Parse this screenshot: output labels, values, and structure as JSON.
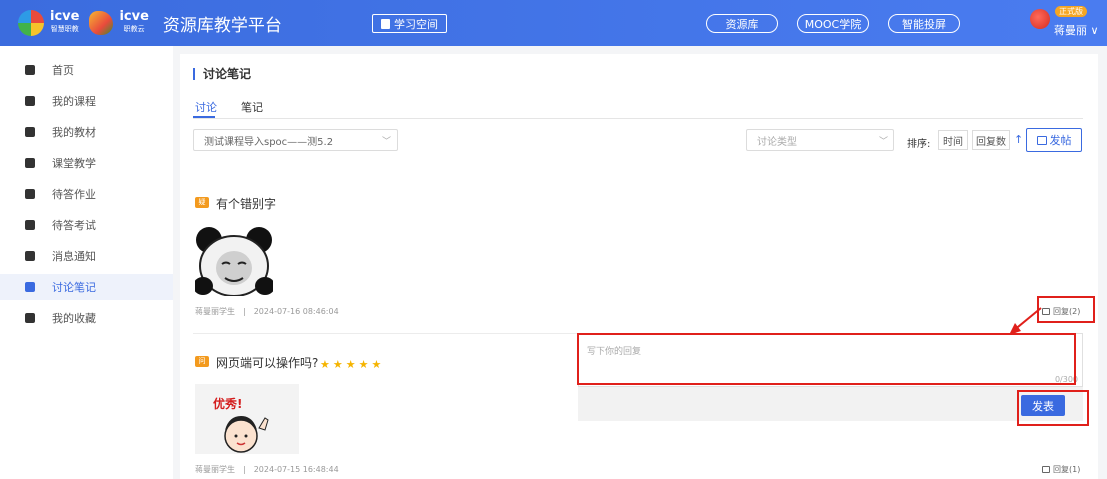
{
  "header": {
    "logo1_text": "icve",
    "logo1_sub": "智慧职教",
    "logo2_text": "icve",
    "logo2_sub": "职教云",
    "platform_title": "资源库教学平台",
    "study_space": "学习空间",
    "nav": [
      "资源库",
      "MOOC学院",
      "智能投屏"
    ],
    "vip_badge": "正式版",
    "username": "蒋曼丽 ∨"
  },
  "sidebar": {
    "items": [
      {
        "label": "首页",
        "icon": "home-icon"
      },
      {
        "label": "我的课程",
        "icon": "course-icon"
      },
      {
        "label": "我的教材",
        "icon": "book-icon"
      },
      {
        "label": "课堂教学",
        "icon": "classroom-icon"
      },
      {
        "label": "待答作业",
        "icon": "homework-icon"
      },
      {
        "label": "待答考试",
        "icon": "exam-icon"
      },
      {
        "label": "消息通知",
        "icon": "message-icon"
      },
      {
        "label": "讨论笔记",
        "icon": "discussion-icon"
      },
      {
        "label": "我的收藏",
        "icon": "favorite-icon"
      }
    ],
    "active_index": 7
  },
  "main": {
    "title": "讨论笔记",
    "tabs": [
      "讨论",
      "笔记"
    ],
    "course_select": "测试课程导入spoc——测5.2",
    "type_placeholder": "讨论类型",
    "sort_label": "排序:",
    "sort_options": [
      "时间",
      "回复数"
    ],
    "sort_arrow": "↑",
    "post_button": "发帖"
  },
  "posts": [
    {
      "tag": "疑",
      "title": "有个错别字",
      "author": "蒋曼丽学生",
      "sep": "|",
      "time": "2024-07-16 08:46:04",
      "reply": "回复(2)"
    },
    {
      "tag": "问",
      "title": "网页端可以操作吗?",
      "stars": "★★★★★",
      "meme_text": "优秀!",
      "author": "蒋曼丽学生",
      "sep": "|",
      "time": "2024-07-15 16:48:44",
      "reply": "回复(1)"
    }
  ],
  "reply_panel": {
    "placeholder": "写下你的回复",
    "count": "0/300",
    "send": "发表"
  },
  "colors": {
    "brand": "#3a6ae0",
    "highlight": "#e0201b",
    "star": "#f5b400",
    "tag": "#f39a1e"
  }
}
